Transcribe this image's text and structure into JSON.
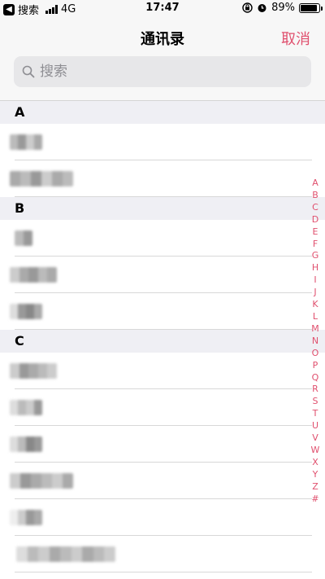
{
  "status_bar": {
    "back_app": "搜索",
    "network": "4G",
    "time": "17:47",
    "battery": "89%",
    "battery_level": 0.89
  },
  "navbar": {
    "title": "通讯录",
    "cancel": "取消"
  },
  "search": {
    "placeholder": "搜索"
  },
  "sections": [
    {
      "letter": "A",
      "rows": 2
    },
    {
      "letter": "B",
      "rows": 3
    },
    {
      "letter": "C",
      "rows": 6
    }
  ],
  "index_letters": [
    "A",
    "B",
    "C",
    "D",
    "E",
    "F",
    "G",
    "H",
    "I",
    "J",
    "K",
    "L",
    "M",
    "N",
    "O",
    "P",
    "Q",
    "R",
    "S",
    "T",
    "U",
    "V",
    "W",
    "X",
    "Y",
    "Z",
    "#"
  ],
  "colors": {
    "accent": "#e0506e",
    "section_bg": "#efeff4",
    "separator": "#d8d8d8"
  }
}
